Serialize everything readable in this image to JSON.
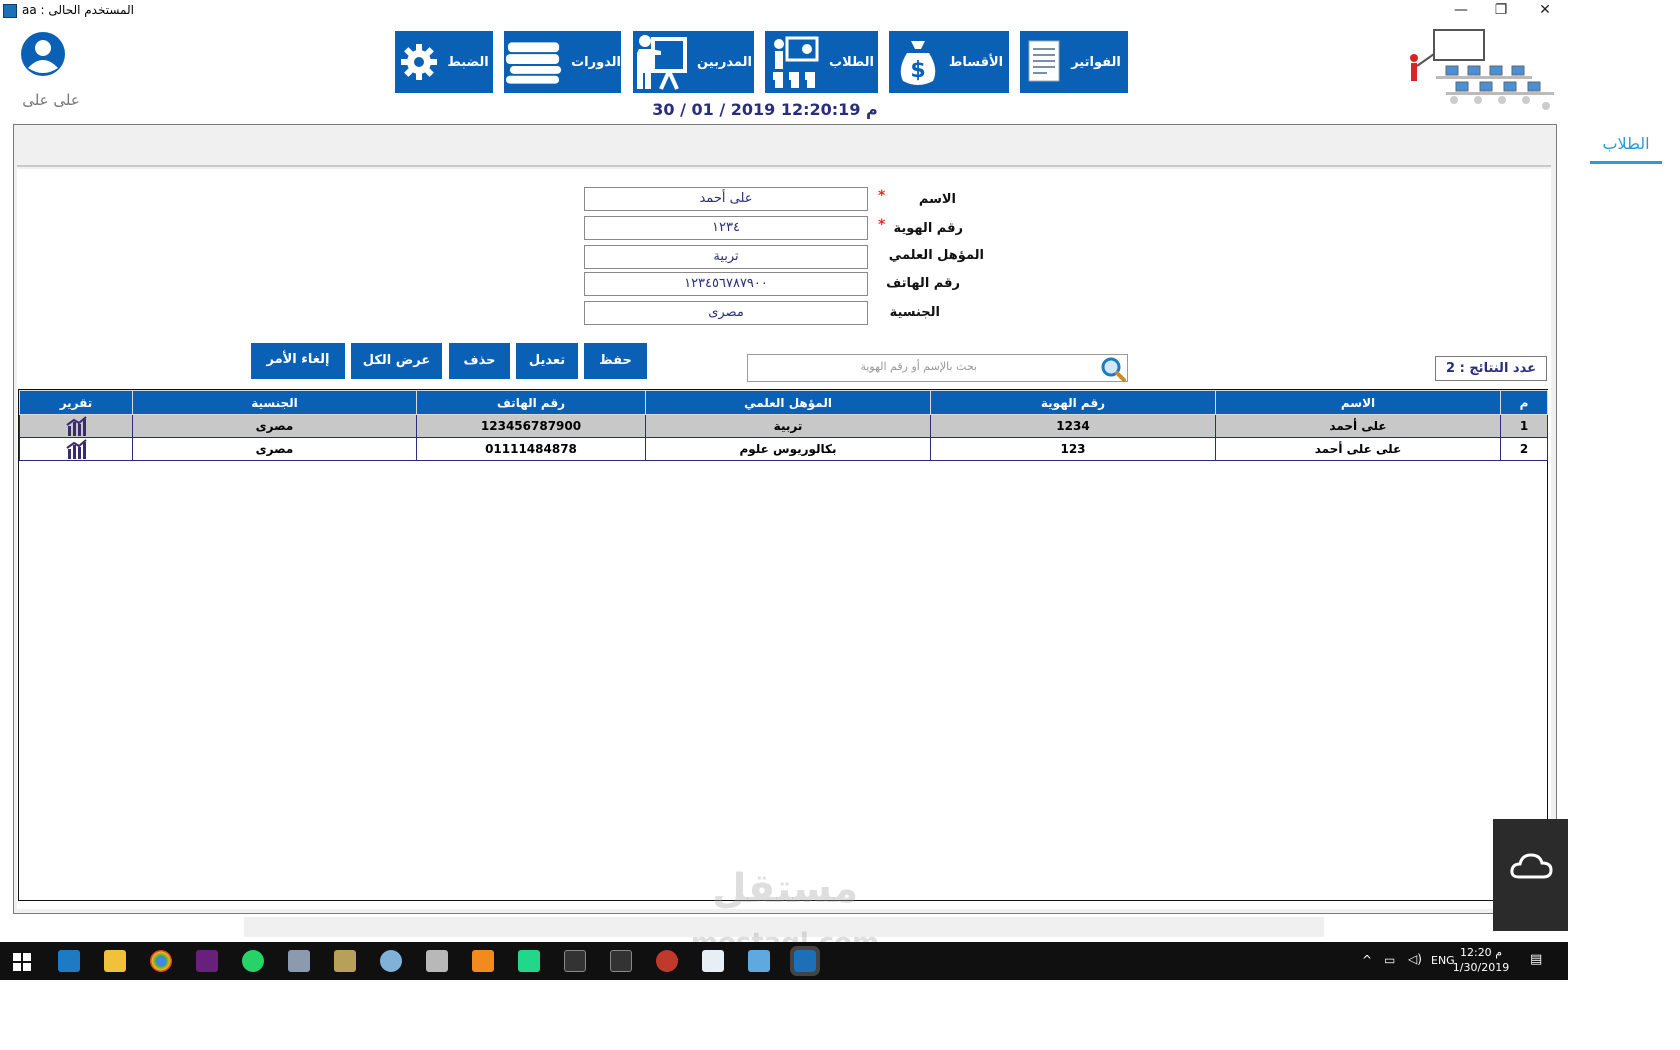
{
  "window": {
    "title": "المستخدم الحالى : aa",
    "controls": [
      "—",
      "❐",
      "✕"
    ]
  },
  "header": {
    "nav": [
      {
        "label": "الفواتير",
        "icon": "invoice-document-icon"
      },
      {
        "label": "الأقساط",
        "icon": "money-bag-icon"
      },
      {
        "label": "الطلاب",
        "icon": "students-presentation-icon"
      },
      {
        "label": "المدربين",
        "icon": "trainer-board-icon"
      },
      {
        "label": "الدورات",
        "icon": "books-stack-icon"
      },
      {
        "label": "الضبط",
        "icon": "gear-icon"
      }
    ],
    "datetime": "30 / 01 / 2019   12:20:19  م",
    "user_name": "على على",
    "user_icon": "user-avatar-icon",
    "logo_icon": "classroom-illustration"
  },
  "tab": {
    "label": "الطلاب"
  },
  "form": {
    "fields": [
      {
        "label": "الاسم",
        "value": "على أحمد",
        "required": true
      },
      {
        "label": "رقم الهوية",
        "value": "١٢٣٤",
        "required": true
      },
      {
        "label": "المؤهل العلمي",
        "value": "تربية",
        "required": false
      },
      {
        "label": "رقم الهاتف",
        "value": "١٢٣٤٥٦٧٨٧٩٠٠",
        "required": false
      },
      {
        "label": "الجنسية",
        "value": "مصرى",
        "required": false
      }
    ],
    "required_mark": "*"
  },
  "actions": {
    "save": "حفظ",
    "edit": "تعديل",
    "delete": "حذف",
    "show_all": "عرض الكل",
    "cancel": "إلغاء الأمر"
  },
  "search": {
    "placeholder": "بحث بالإسم   أو رقم الهوية",
    "icon": "search-icon"
  },
  "result_count": "عدد النتائج : 2",
  "grid": {
    "columns": [
      "م",
      "الاسم",
      "رقم الهوية",
      "المؤهل العلمي",
      "رقم الهاتف",
      "الجنسية",
      "تقرير"
    ],
    "rows": [
      {
        "num": "1",
        "name": "على أحمد",
        "id": "1234",
        "qualification": "تربية",
        "phone": "123456787900",
        "nationality": "مصرى",
        "report_icon": "report-chart-icon",
        "selected": true
      },
      {
        "num": "2",
        "name": "على على أحمد",
        "id": "123",
        "qualification": "بكالوريوس علوم",
        "phone": "01111484878",
        "nationality": "مصرى",
        "report_icon": "report-chart-icon",
        "selected": false
      }
    ]
  },
  "watermark": {
    "arabic": "مستقل",
    "latin": "mostaql.com"
  },
  "taskbar": {
    "language": "ENG",
    "time": "12:20 م",
    "date": "1/30/2019"
  }
}
